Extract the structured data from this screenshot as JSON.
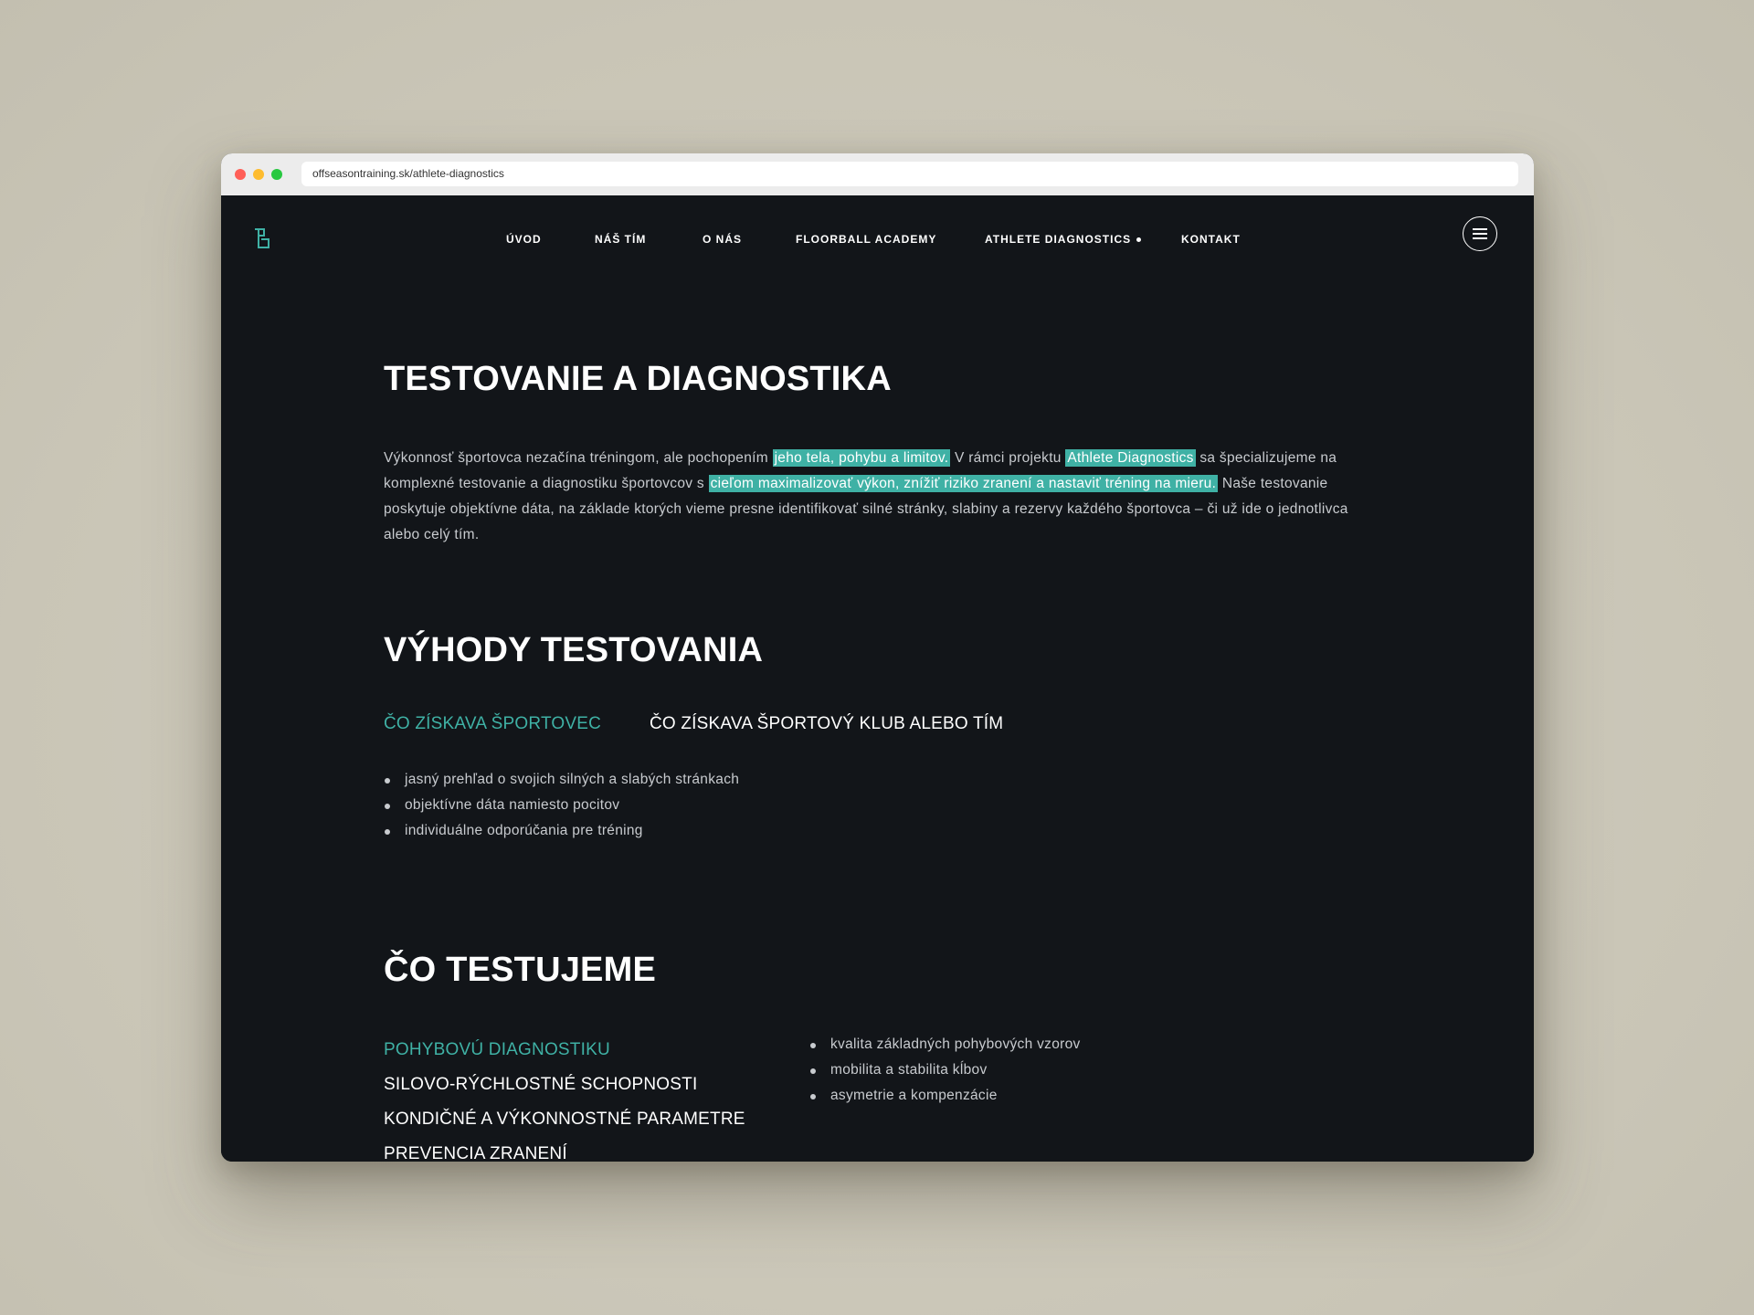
{
  "browser": {
    "url": "offseasontraining.sk/athlete-diagnostics"
  },
  "nav": {
    "items": [
      {
        "label": "ÚVOD"
      },
      {
        "label": "NÁŠ TÍM"
      },
      {
        "label": "O NÁS"
      },
      {
        "label": "FLOORBALL ACADEMY"
      },
      {
        "label": "ATHLETE DIAGNOSTICS"
      },
      {
        "label": "KONTAKT"
      }
    ],
    "active_item": "ATHLETE DIAGNOSTICS"
  },
  "hero": {
    "title": "TESTOVANIE A DIAGNOSTIKA",
    "intro_1": "Výkonnosť športovca nezačína tréningom, ale pochopením ",
    "intro_hl_1": "jeho tela, pohybu a limitov.",
    "intro_2": " V rámci projektu ",
    "intro_hl_2": "Athlete Diagnostics",
    "intro_3": " sa špecializujeme na komplexné testovanie a diagnostiku športovcov s ",
    "intro_hl_3": "cieľom maximalizovať výkon, znížiť riziko zranení a nastaviť tréning na mieru.",
    "intro_4": " Naše testovanie poskytuje objektívne dáta, na základe ktorých vieme presne identifikovať silné stránky, slabiny a rezervy každého športovca – či už ide o jednotlivca alebo celý tím."
  },
  "benefits": {
    "title": "VÝHODY TESTOVANIA",
    "tabs": [
      {
        "label": "ČO ZÍSKAVA ŠPORTOVEC"
      },
      {
        "label": "ČO ZÍSKAVA ŠPORTOVÝ KLUB ALEBO TÍM"
      }
    ],
    "active_tab": "ČO ZÍSKAVA ŠPORTOVEC",
    "items": [
      "jasný prehľad o svojich silných a slabých stránkach",
      "objektívne dáta namiesto pocitov",
      "individuálne odporúčania pre tréning"
    ]
  },
  "tests": {
    "title": "ČO TESTUJEME",
    "categories": [
      {
        "label": "POHYBOVÚ DIAGNOSTIKU"
      },
      {
        "label": "SILOVO-RÝCHLOSTNÉ SCHOPNOSTI"
      },
      {
        "label": "KONDIČNÉ A VÝKONNOSTNÉ PARAMETRE"
      },
      {
        "label": "PREVENCIA ZRANENÍ"
      }
    ],
    "active_category": "POHYBOVÚ DIAGNOSTIKU",
    "items": [
      "kvalita základných pohybových vzorov",
      "mobilita a stabilita kĺbov",
      "asymetrie a kompenzácie"
    ]
  },
  "colors": {
    "accent": "#3fb1a5",
    "page_background": "#121519",
    "backdrop": "#cdc9bb",
    "body_text": "#c8cbcf"
  },
  "icons": {
    "logo": "logo-icon",
    "menu": "hamburger-menu-icon"
  }
}
